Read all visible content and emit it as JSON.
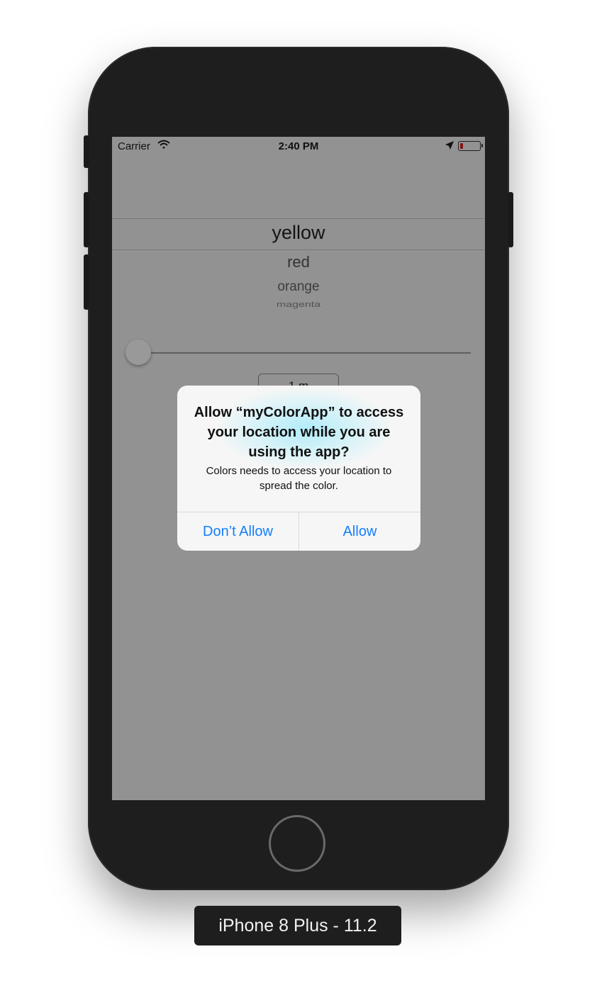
{
  "device": {
    "label": "iPhone 8 Plus - 11.2"
  },
  "status_bar": {
    "carrier": "Carrier",
    "time": "2:40 PM",
    "wifi_icon": "wifi-icon",
    "location_icon": "location-arrow-icon",
    "battery_icon": "battery-low-icon",
    "battery_color": "#e02020"
  },
  "picker": {
    "selected": "yellow",
    "items": [
      "red",
      "orange",
      "magenta"
    ]
  },
  "slider": {
    "value": 0.0
  },
  "unit_field": {
    "value": "1 m"
  },
  "alert": {
    "title": "Allow “myColorApp” to access your location while you are using the app?",
    "message": "Colors needs to access your location to spread the color.",
    "dont_allow_label": "Don’t Allow",
    "allow_label": "Allow",
    "button_color": "#147efb"
  }
}
